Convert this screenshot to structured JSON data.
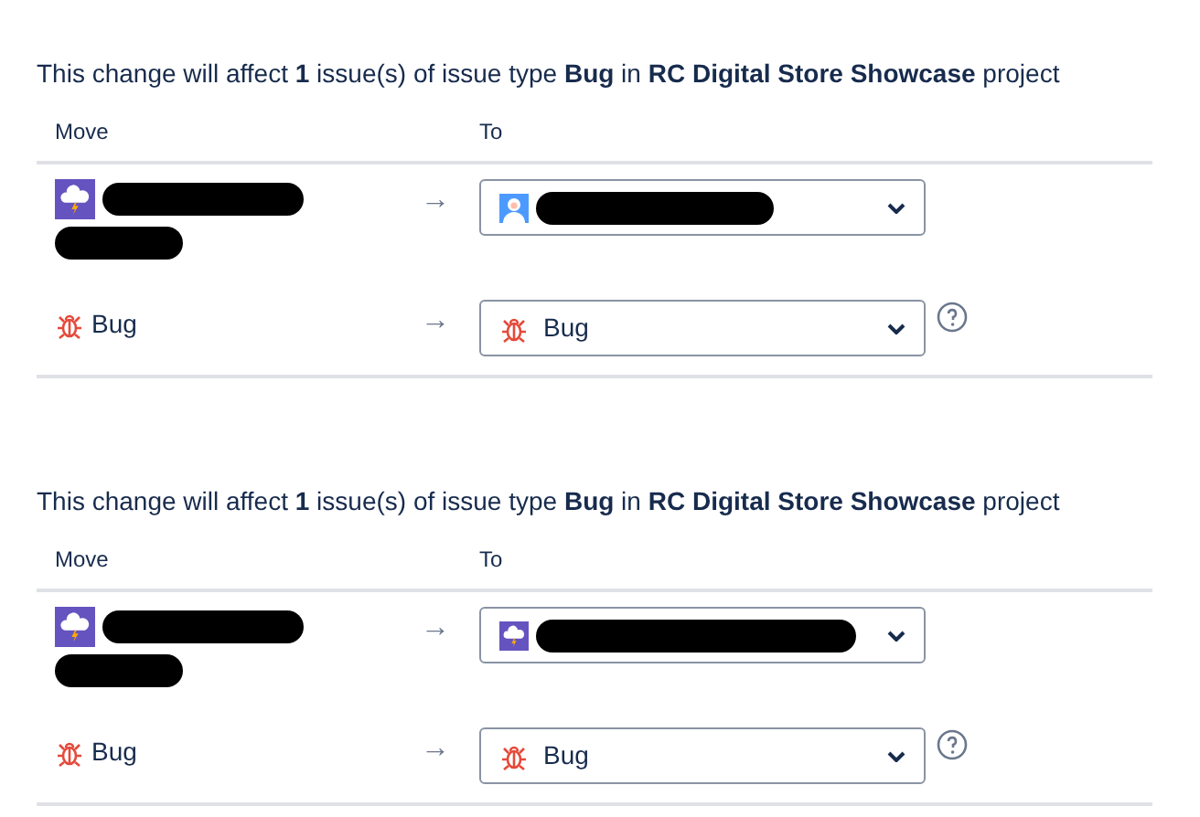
{
  "sections": [
    {
      "message": "This change will affect **1** issue(s) of issue type **Bug** in **RC Digital Store Showcase** project",
      "columns": [
        "Move",
        "To"
      ],
      "rows": [
        {
          "kind": "project",
          "arrow": "→",
          "target": {
            "kind": "user"
          }
        },
        {
          "kind": "issue_type",
          "label": "Bug",
          "arrow": "→",
          "value": "Bug",
          "help": true
        }
      ]
    },
    {
      "message": "This change will affect **1** issue(s) of issue type **Bug** in **RC Digital Store Showcase** project",
      "columns": [
        "Move",
        "To"
      ],
      "rows": [
        {
          "kind": "project",
          "arrow": "→",
          "target": {
            "kind": "project"
          }
        },
        {
          "kind": "issue_type",
          "label": "Bug",
          "arrow": "→",
          "value": "Bug",
          "help": true
        }
      ]
    }
  ]
}
